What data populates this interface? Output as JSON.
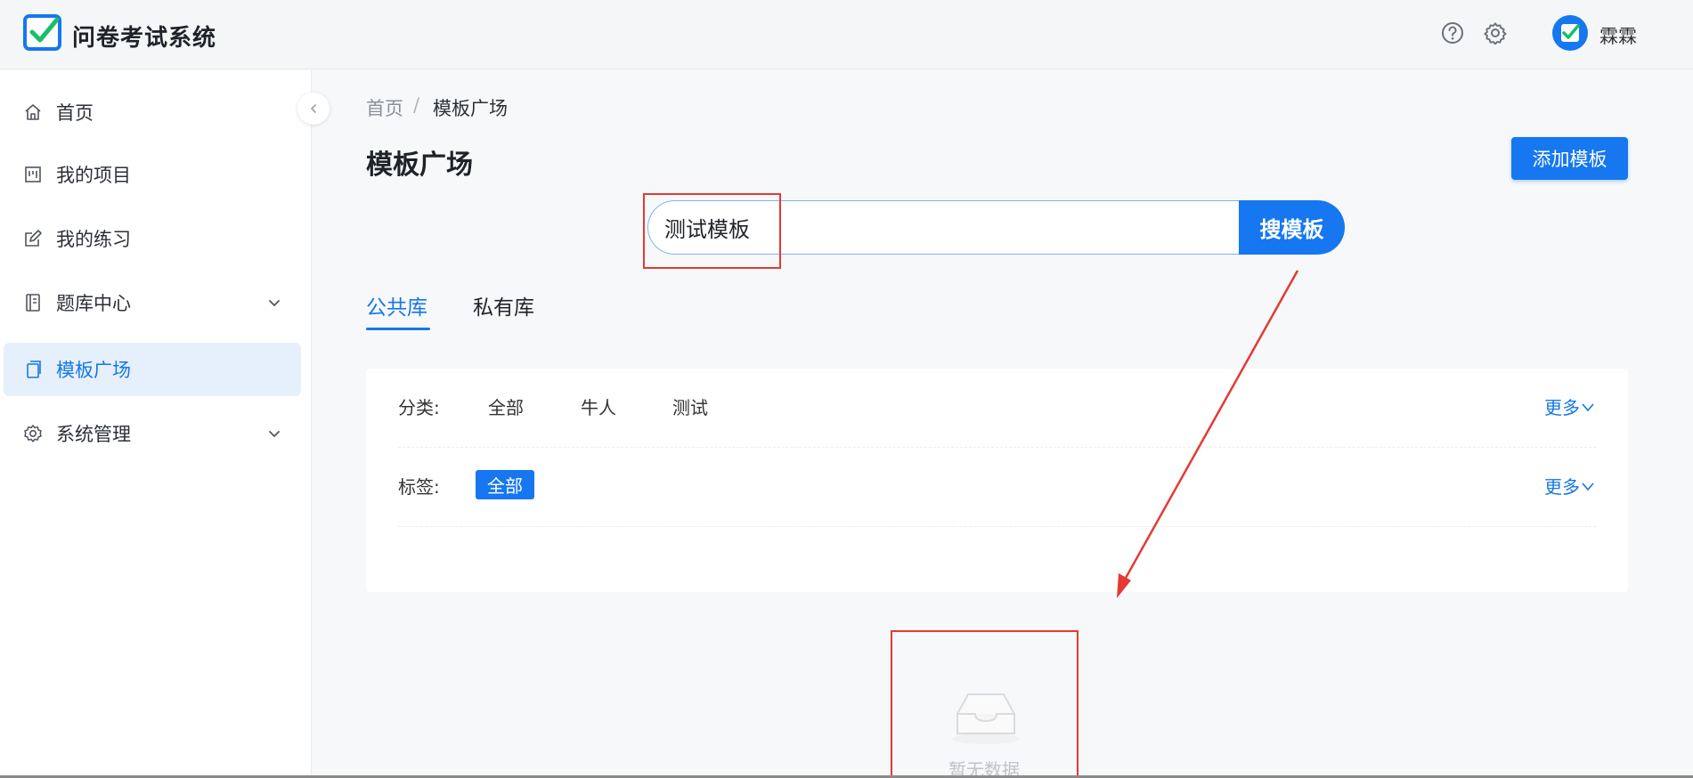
{
  "header": {
    "app_title": "问卷考试系统",
    "username": "霖霖",
    "icons": [
      "help-icon",
      "settings-icon"
    ],
    "brand_color": "#1677f0",
    "logo_check_color": "#19be6b"
  },
  "sidebar": {
    "items": [
      {
        "label": "首页",
        "icon": "home-icon"
      },
      {
        "label": "我的项目",
        "icon": "project-icon"
      },
      {
        "label": "我的练习",
        "icon": "edit-icon"
      },
      {
        "label": "题库中心",
        "icon": "book-icon",
        "has_submenu": true
      },
      {
        "label": "模板广场",
        "icon": "copy-icon",
        "active": true
      },
      {
        "label": "系统管理",
        "icon": "gear-icon",
        "has_submenu": true
      }
    ]
  },
  "breadcrumb": {
    "home": "首页",
    "separator": "/",
    "current": "模板广场"
  },
  "main": {
    "title": "模板广场",
    "add_button": "添加模板",
    "search": {
      "value": "测试模板",
      "button": "搜模板"
    },
    "tabs": [
      {
        "label": "公共库",
        "active": true
      },
      {
        "label": "私有库",
        "active": false
      }
    ],
    "filters": {
      "category": {
        "label": "分类:",
        "options": [
          "全部",
          "牛人",
          "测试"
        ],
        "more": "更多"
      },
      "tags": {
        "label": "标签:",
        "options": [
          "全部"
        ],
        "selected": "全部",
        "more": "更多"
      }
    },
    "empty_text": "暂无数据"
  },
  "annotation_color": "#e53935"
}
